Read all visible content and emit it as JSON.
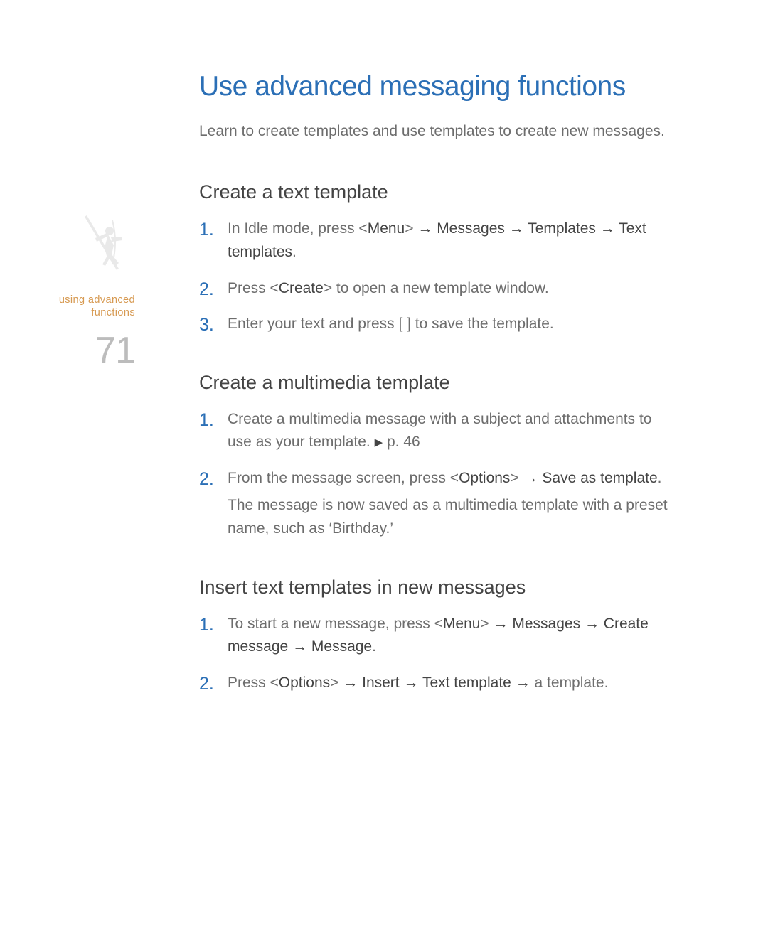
{
  "sidebar": {
    "label_line1": "using advanced",
    "label_line2": "functions",
    "page_number": "71"
  },
  "title": "Use advanced messaging functions",
  "intro": "Learn to create templates and use templates to create new messages.",
  "sections": [
    {
      "heading": "Create a text template",
      "steps": [
        {
          "num": "1.",
          "parts": {
            "t0": "In Idle mode, press <",
            "k0": "Menu",
            "t1": "> ",
            "a0": "→",
            "t2": " ",
            "k1": "Messages",
            "t3": " ",
            "a1": "→",
            "t4": " ",
            "k2": "Templates",
            "t5": " ",
            "a2": "→",
            "t6": " ",
            "k3": "Text templates",
            "t7": "."
          }
        },
        {
          "num": "2.",
          "parts": {
            "t0": "Press <",
            "k0": "Create",
            "t1": "> to open a new template window."
          }
        },
        {
          "num": "3.",
          "parts": {
            "t0": "Enter your text and press [  ] to save the template."
          }
        }
      ]
    },
    {
      "heading": "Create a multimedia template",
      "steps": [
        {
          "num": "1.",
          "parts": {
            "t0": "Create a multimedia message with a subject and attachments to use as your template. ",
            "tri": "▶",
            "t1": " p. 46"
          }
        },
        {
          "num": "2.",
          "parts": {
            "t0": "From the message screen, press <",
            "k0": "Options",
            "t1": "> ",
            "a0": "→",
            "t2": " ",
            "k1": "Save as template",
            "t3": "."
          },
          "note": "The message is now saved as a multimedia template with a preset name, such as ‘Birthday.’"
        }
      ]
    },
    {
      "heading": "Insert text templates in new messages",
      "steps": [
        {
          "num": "1.",
          "parts": {
            "t0": "To start a new message, press <",
            "k0": "Menu",
            "t1": "> ",
            "a0": "→",
            "t2": " ",
            "k1": "Messages",
            "t3": " ",
            "a1": "→",
            "t4": " ",
            "k2": "Create message",
            "t5": " ",
            "a2": "→",
            "t6": " ",
            "k3": "Message",
            "t7": "."
          }
        },
        {
          "num": "2.",
          "parts": {
            "t0": "Press <",
            "k0": "Options",
            "t1": "> ",
            "a0": "→",
            "t2": " ",
            "k1": "Insert",
            "t3": " ",
            "a1": "→",
            "t4": " ",
            "k2": "Text template",
            "t5": " ",
            "a2": "→",
            "t6": " a template."
          }
        }
      ]
    }
  ]
}
